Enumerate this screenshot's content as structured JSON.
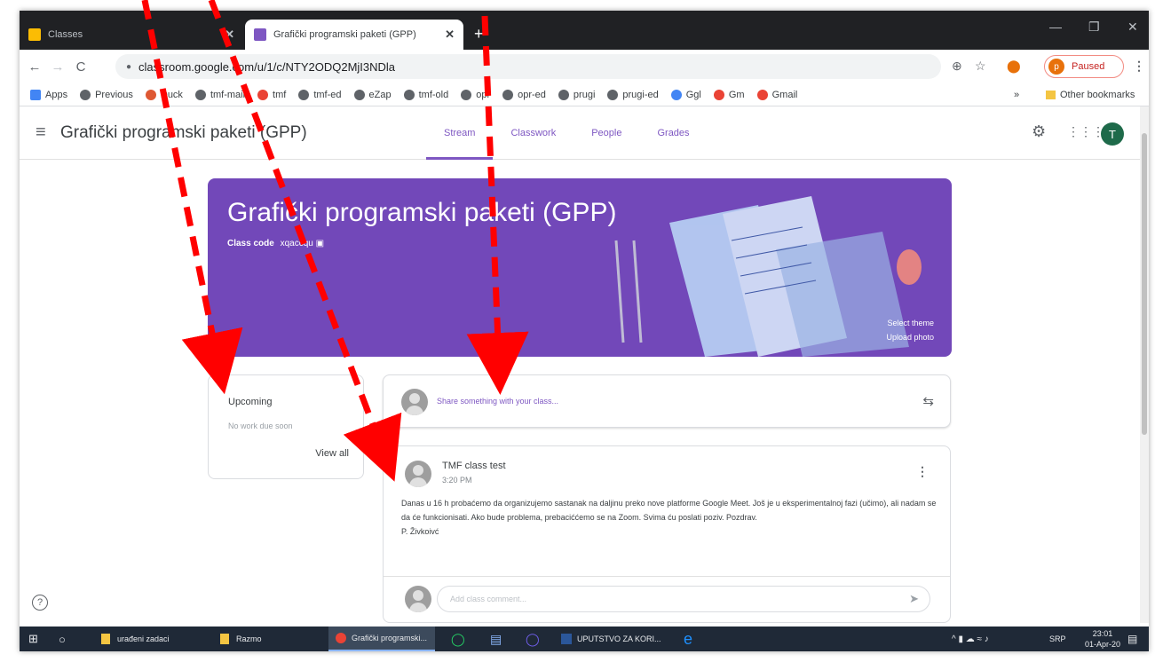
{
  "browser": {
    "tabs": [
      {
        "label": "Classes",
        "close": "✕",
        "favicon_color": "#fbbc04"
      },
      {
        "label": "Grafički programski paketi (GPP)",
        "close": "✕",
        "favicon_color": "#7e57c2"
      }
    ],
    "new_tab": "+",
    "window_controls": {
      "minimize": "—",
      "restore": "❐",
      "close": "✕"
    },
    "nav": {
      "back": "←",
      "forward": "→",
      "reload": "C",
      "lock": "🔒"
    },
    "url": "classroom.google.com/u/1/c/NTY2ODQ2MjI3NDla",
    "zoom_icon": "⊕",
    "star_icon": "☆",
    "extension_icon": "⬤",
    "profile": {
      "initial": "p",
      "label": "Paused"
    },
    "menu_icon": "⋮"
  },
  "bookmarks": {
    "items": [
      {
        "label": "Apps",
        "icon": "apps-grid-icon"
      },
      {
        "label": "Previous",
        "icon": "globe-icon"
      },
      {
        "label": "Duck",
        "icon": "duck-icon"
      },
      {
        "label": "tmf-mail",
        "icon": "globe-icon"
      },
      {
        "label": "tmf",
        "icon": "gmail-icon"
      },
      {
        "label": "tmf-ed",
        "icon": "globe-icon"
      },
      {
        "label": "eZap",
        "icon": "globe-icon"
      },
      {
        "label": "tmf-old",
        "icon": "globe-icon"
      },
      {
        "label": "opr",
        "icon": "globe-icon"
      },
      {
        "label": "opr-ed",
        "icon": "globe-icon"
      },
      {
        "label": "prugi",
        "icon": "globe-icon"
      },
      {
        "label": "prugi-ed",
        "icon": "globe-icon"
      },
      {
        "label": "Ggl",
        "icon": "google-icon"
      },
      {
        "label": "Gm",
        "icon": "gmail-icon"
      },
      {
        "label": "Gmail",
        "icon": "gmail-icon"
      }
    ],
    "overflow": "»",
    "other": "Other bookmarks"
  },
  "classroom": {
    "title": "Grafički programski paketi (GPP)",
    "tabs": [
      "Stream",
      "Classwork",
      "People",
      "Grades"
    ],
    "active_tab": "Stream",
    "avatar_initial": "T",
    "banner": {
      "title": "Grafički programski paketi (GPP)",
      "class_code_label": "Class code",
      "class_code": "xqaccqu",
      "select_theme": "Select theme",
      "upload_photo": "Upload photo",
      "color": "#7248b9"
    },
    "upcoming": {
      "title": "Upcoming",
      "subtitle": "No work due soon",
      "link": "View all"
    },
    "share_placeholder": "Share something with your class...",
    "post": {
      "author": "TMF class test",
      "time": "3:20 PM",
      "body": "Danas u 16 h probaćemo da organizujemo sastanak na daljinu preko nove platforme Google Meet. Još je u eksperimentalnoj fazi (učimo), ali nadam se da će funkcionisati. Ako bude problema, prebaciććemo se na Zoom. Svima ću poslati poziv. Pozdrav.",
      "signature": "P. Živkoivć",
      "comment_placeholder": "Add class comment..."
    },
    "help": "?"
  },
  "taskbar": {
    "items": [
      {
        "label": "urađeni zadaci"
      },
      {
        "label": "Razmo"
      },
      {
        "label": "Grafički programski..."
      },
      {
        "label": "UPUTSTVO ZA KORI..."
      }
    ],
    "language": "SRP",
    "time": "23:01",
    "date": "01-Apr-20"
  },
  "colors": {
    "accent": "#7e57c2",
    "annotation": "#ff0000",
    "taskbar": "#1f2937"
  }
}
